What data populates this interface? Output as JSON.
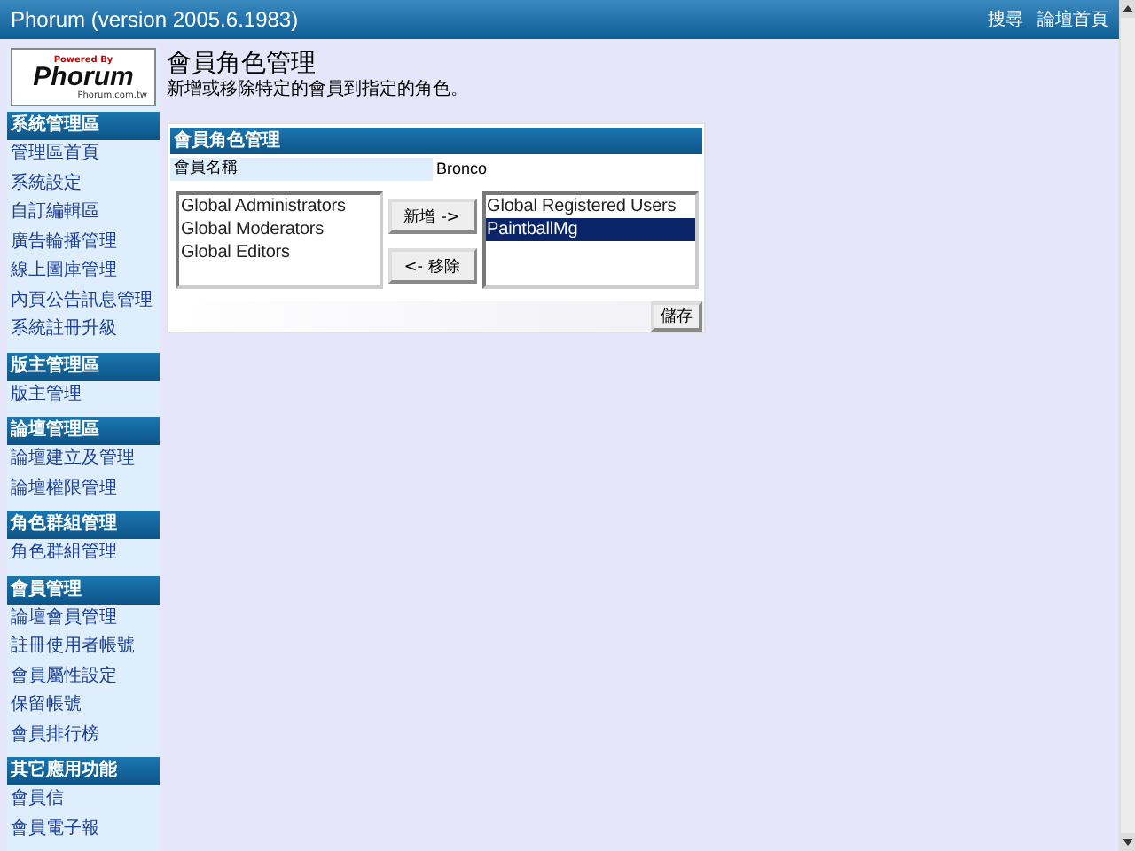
{
  "top_bar": {
    "title": "Phorum (version 2005.6.1983)",
    "links": [
      "搜尋",
      "論壇首頁"
    ]
  },
  "logo": {
    "powered": "Powered By",
    "name": "Phorum",
    "site": "Phorum.com.tw"
  },
  "sidebar": {
    "sections": [
      {
        "title": "系統管理區",
        "items": [
          "管理區首頁",
          "系統設定",
          "自訂編輯區",
          "廣告輪播管理",
          "線上圖庫管理",
          "內頁公告訊息管理",
          "系統註冊升級"
        ]
      },
      {
        "title": "版主管理區",
        "items": [
          "版主管理"
        ]
      },
      {
        "title": "論壇管理區",
        "items": [
          "論壇建立及管理",
          "論壇權限管理"
        ]
      },
      {
        "title": "角色群組管理",
        "items": [
          "角色群組管理"
        ]
      },
      {
        "title": "會員管理",
        "items": [
          "論壇會員管理",
          "註冊使用者帳號",
          "會員屬性設定",
          "保留帳號",
          "會員排行榜"
        ]
      },
      {
        "title": "其它應用功能",
        "items": [
          "會員信",
          "會員電子報"
        ]
      }
    ]
  },
  "page": {
    "title": "會員角色管理",
    "subtitle": "新增或移除特定的會員到指定的角色。"
  },
  "panel": {
    "title": "會員角色管理",
    "member_label": "會員名稱",
    "member_name": "Bronco",
    "available_roles": [
      {
        "label": "Global Administrators",
        "selected": false
      },
      {
        "label": "Global Moderators",
        "selected": false
      },
      {
        "label": "Global Editors",
        "selected": false
      }
    ],
    "add_button": "新增 ->",
    "remove_button": "<- 移除",
    "assigned_roles": [
      {
        "label": "Global Registered Users",
        "selected": false
      },
      {
        "label": "PaintballMg",
        "selected": true
      }
    ],
    "save_button": "儲存"
  }
}
